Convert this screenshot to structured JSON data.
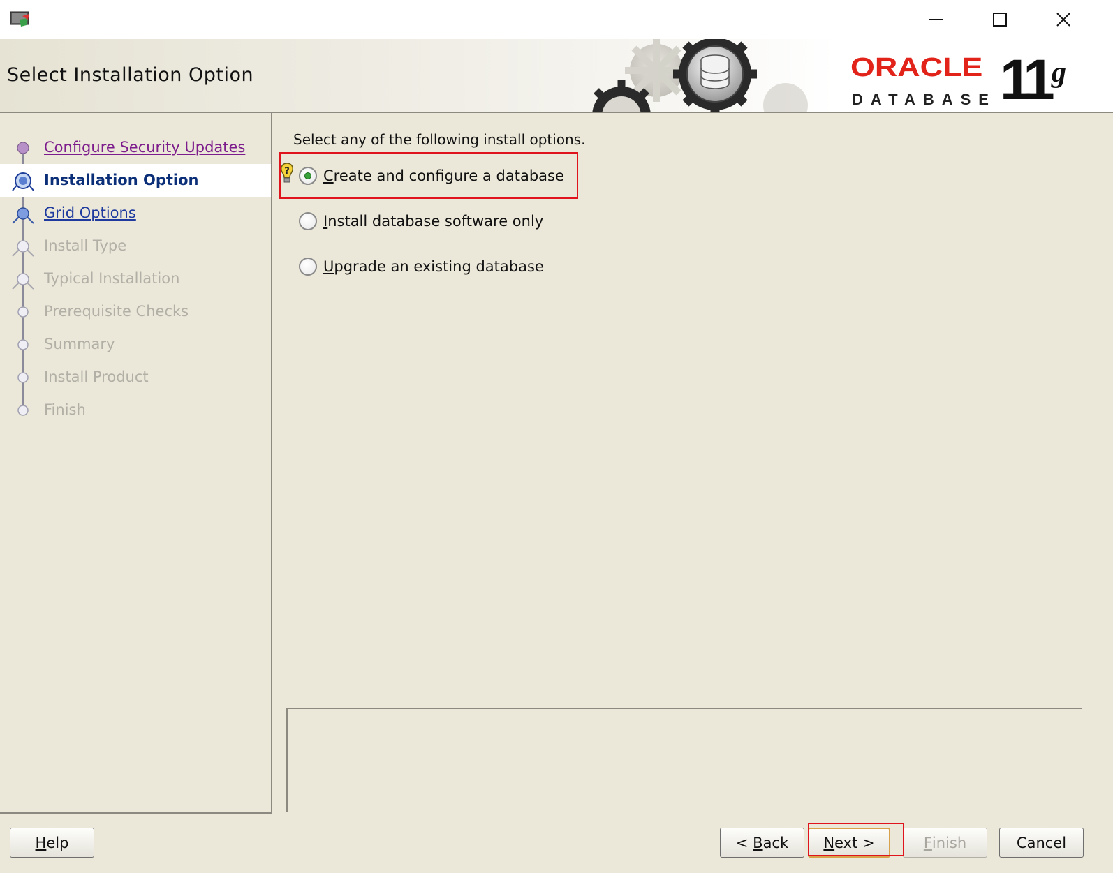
{
  "window": {
    "controls": {
      "minimize": "minimize",
      "maximize": "maximize",
      "close": "close"
    }
  },
  "header": {
    "page_title": "Select Installation Option",
    "brand": {
      "oracle": "ORACLE",
      "product": "DATABASE",
      "version_number": "11",
      "version_suffix": "g"
    }
  },
  "nav": {
    "items": [
      {
        "label": "Configure Security Updates",
        "state": "visited"
      },
      {
        "label": "Installation Option",
        "state": "active"
      },
      {
        "label": "Grid Options",
        "state": "link"
      },
      {
        "label": "Install Type",
        "state": "disabled"
      },
      {
        "label": "Typical Installation",
        "state": "disabled"
      },
      {
        "label": "Prerequisite Checks",
        "state": "disabled"
      },
      {
        "label": "Summary",
        "state": "disabled"
      },
      {
        "label": "Install Product",
        "state": "disabled"
      },
      {
        "label": "Finish",
        "state": "disabled"
      }
    ]
  },
  "main": {
    "instruction": "Select any of the following install options.",
    "options": [
      {
        "mnemonic": "C",
        "rest": "reate and configure a database",
        "selected": true
      },
      {
        "mnemonic": "I",
        "rest": "nstall database software only",
        "selected": false
      },
      {
        "mnemonic": "U",
        "rest": "pgrade an existing database",
        "selected": false
      }
    ],
    "description": ""
  },
  "footer": {
    "help": {
      "mnemonic": "H",
      "rest": "elp"
    },
    "back": {
      "prefix": "< ",
      "mnemonic": "B",
      "rest": "ack"
    },
    "next": {
      "mnemonic": "N",
      "rest": "ext >"
    },
    "finish": {
      "mnemonic": "F",
      "rest": "inish"
    },
    "cancel": "Cancel"
  },
  "colors": {
    "background": "#ebe8d9",
    "highlight_box": "#e0141c",
    "oracle_red": "#e2231a",
    "active_nav": "#0a2e78",
    "visited_nav": "#7d1c8c"
  }
}
